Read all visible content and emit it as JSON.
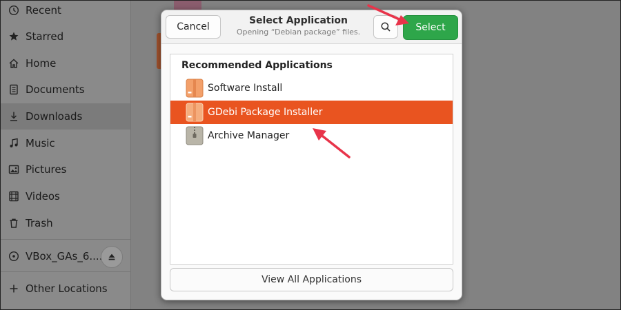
{
  "sidebar": {
    "items": [
      {
        "label": "Recent",
        "icon": "clock-icon"
      },
      {
        "label": "Starred",
        "icon": "star-icon"
      },
      {
        "label": "Home",
        "icon": "home-icon"
      },
      {
        "label": "Documents",
        "icon": "document-icon"
      },
      {
        "label": "Downloads",
        "icon": "download-icon",
        "active": true
      },
      {
        "label": "Music",
        "icon": "music-note-icon"
      },
      {
        "label": "Pictures",
        "icon": "picture-icon"
      },
      {
        "label": "Videos",
        "icon": "video-icon"
      },
      {
        "label": "Trash",
        "icon": "trash-icon"
      }
    ],
    "volume": {
      "label": "VBox_GAs_6....",
      "icon": "disc-icon",
      "eject_icon": "eject-icon"
    },
    "other_locations": {
      "label": "Other Locations",
      "icon": "plus-icon"
    }
  },
  "dialog": {
    "cancel_label": "Cancel",
    "title": "Select Application",
    "subtitle": "Opening “Debian package” files.",
    "search_icon": "search-icon",
    "select_label": "Select",
    "list_heading": "Recommended Applications",
    "apps": [
      {
        "label": "Software Install",
        "icon": "package-icon"
      },
      {
        "label": "GDebi Package Installer",
        "icon": "package-icon",
        "selected": true
      },
      {
        "label": "Archive Manager",
        "icon": "archive-icon"
      }
    ],
    "view_all_label": "View All Applications"
  },
  "colors": {
    "accent_select": "#2ea64a",
    "selection": "#e95420",
    "annotation_arrow": "#e8344a"
  }
}
